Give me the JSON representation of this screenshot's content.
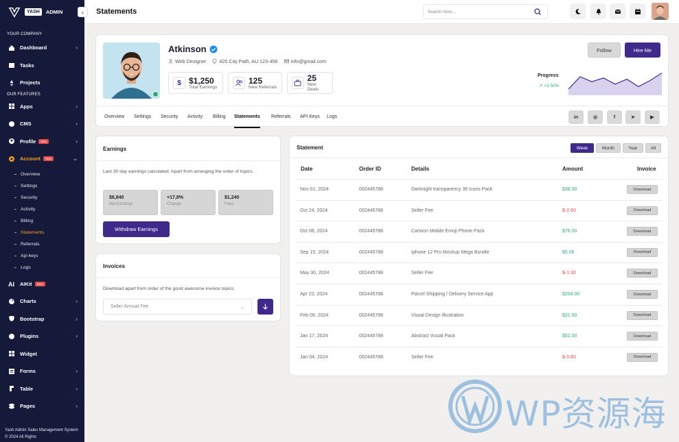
{
  "brand": {
    "box": "YASH",
    "text": "ADMIN"
  },
  "sidebar": {
    "section_company": "YOUR COMPANY",
    "section_features": "OUR FEATURES",
    "company_items": [
      {
        "label": "Dashboard",
        "icon": "home-icon"
      },
      {
        "label": "Tasks",
        "icon": "calendar-icon"
      },
      {
        "label": "Projects",
        "icon": "rocket-icon"
      }
    ],
    "feature_items_a": [
      {
        "label": "Apps",
        "icon": "grid-icon"
      },
      {
        "label": "CMS",
        "icon": "monitor-icon"
      },
      {
        "label": "Profile",
        "icon": "user-icon",
        "badge": "New"
      },
      {
        "label": "Account",
        "icon": "settings-icon",
        "badge": "New"
      }
    ],
    "sub_items": [
      "Overview",
      "Settings",
      "Security",
      "Activity",
      "Billing",
      "Statements",
      "Referrals",
      "Api keys",
      "Logs"
    ],
    "feature_items_b": [
      {
        "label": "AIKit",
        "icon": "ai-icon",
        "badge": "New"
      },
      {
        "label": "Charts",
        "icon": "chart-icon"
      },
      {
        "label": "Bootstrap",
        "icon": "bootstrap-icon"
      },
      {
        "label": "Plugins",
        "icon": "plug-icon"
      },
      {
        "label": "Widget",
        "icon": "widget-icon"
      },
      {
        "label": "Forms",
        "icon": "form-icon"
      },
      {
        "label": "Table",
        "icon": "table-icon"
      },
      {
        "label": "Pages",
        "icon": "pages-icon"
      }
    ],
    "footer": "Yash Admin Sales Management System © 2024 All Rights"
  },
  "topbar": {
    "title": "Statements",
    "search_placeholder": "Search here..."
  },
  "profile": {
    "name": "Atkinson",
    "role": "Web Designer",
    "location": "420 City Path, AU 123-456",
    "email": "info@gmail.com",
    "stats": [
      {
        "value": "$1,250",
        "label": "Total Earnings"
      },
      {
        "value": "125",
        "label": "New Referrals"
      },
      {
        "value": "25",
        "label": "New Deals"
      }
    ],
    "follow": "Follow",
    "hire": "Hire Me",
    "progress_label": "Progress",
    "progress_value": "+3.50%",
    "progress_points": [
      10,
      30,
      22,
      28,
      18,
      26,
      14,
      24,
      36
    ],
    "tabs": [
      "Overview",
      "Settings",
      "Security",
      "Activity",
      "Billing",
      "Statements",
      "Referrals",
      "API Keys",
      "Logs"
    ],
    "social": [
      "in",
      "instagram",
      "f",
      "telegram",
      "youtube"
    ]
  },
  "earnings": {
    "title": "Earnings",
    "description": "Last 30 day earnings calculated. Apart from arranging the order of topics.",
    "minis": [
      {
        "value": "$6,840",
        "label": "Net Earnings"
      },
      {
        "value": "+17,8%",
        "label": "Change"
      },
      {
        "value": "$1,240",
        "label": "Fees"
      }
    ],
    "button": "Withdraw Earnings"
  },
  "invoices": {
    "title": "Invoices",
    "description": "Download apart from order of the good awesome invoice topics.",
    "selected": "Seller Annual Fee"
  },
  "statement": {
    "title": "Statement",
    "ranges": [
      "Week",
      "Month",
      "Year",
      "All"
    ],
    "headers": [
      "Date",
      "Order ID",
      "Details",
      "Amount",
      "Invoice"
    ],
    "download_label": "Download",
    "rows": [
      {
        "date": "Nov 01, 2024",
        "order": "002445788",
        "details": "Darknight transparency 36 Icons Pack",
        "amount": "$38.00",
        "positive": true
      },
      {
        "date": "Oct 24, 2024",
        "order": "002445788",
        "details": "Seller Fee",
        "amount": "$-2.60",
        "positive": false
      },
      {
        "date": "Oct 08, 2024",
        "order": "002445788",
        "details": "Cartoon Mobile Emoji Phone Pack",
        "amount": "$76.00",
        "positive": true
      },
      {
        "date": "Sep 15, 2024",
        "order": "002445788",
        "details": "Iphone 12 Pro Mockup Mega Bundle",
        "amount": "$5.00",
        "positive": true
      },
      {
        "date": "May 30, 2024",
        "order": "002445788",
        "details": "Seller Fee",
        "amount": "$-1.30",
        "positive": false
      },
      {
        "date": "Apr 22, 2024",
        "order": "002445788",
        "details": "Parcel Shipping / Delivery Service App",
        "amount": "$204.00",
        "positive": true
      },
      {
        "date": "Feb 09, 2024",
        "order": "002445788",
        "details": "Visual Design Illustration",
        "amount": "$31.00",
        "positive": true
      },
      {
        "date": "Jan 17, 2024",
        "order": "002445788",
        "details": "Abstract Vusial Pack",
        "amount": "$52.00",
        "positive": true
      },
      {
        "date": "Jan 04, 2024",
        "order": "002445788",
        "details": "Seller Fee",
        "amount": "$-0.80",
        "positive": false
      }
    ]
  },
  "watermark": {
    "text": "WP资源海"
  },
  "colors": {
    "primary": "#3f2a8c",
    "sidebar": "#15193a",
    "accent": "#f0a020",
    "positive": "#2ea97a",
    "negative": "#e74c4c"
  }
}
